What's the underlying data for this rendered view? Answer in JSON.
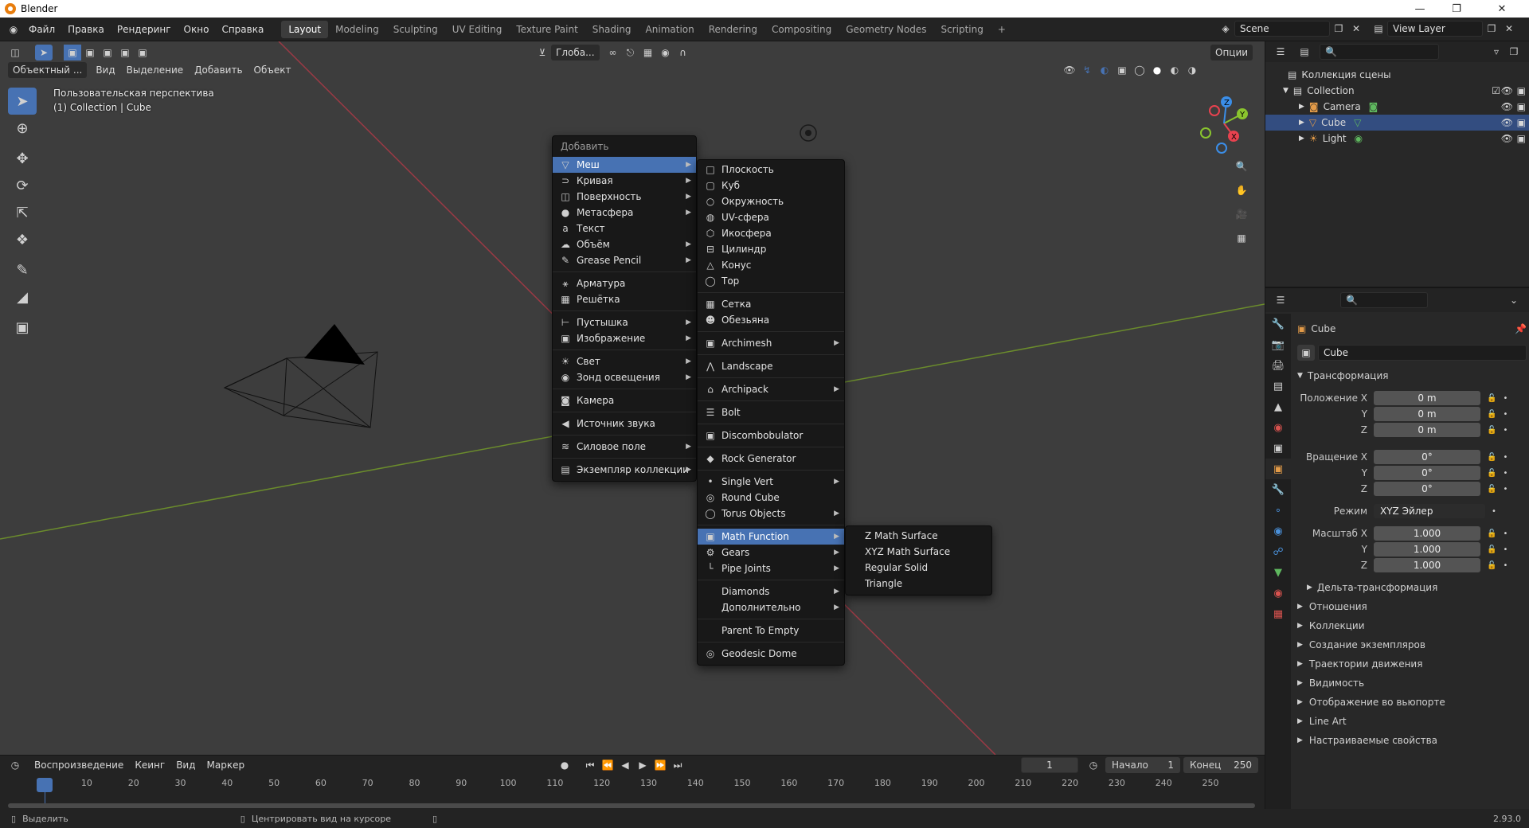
{
  "window": {
    "title": "Blender"
  },
  "topbar": {
    "menus": [
      "Файл",
      "Правка",
      "Рендеринг",
      "Окно",
      "Справка"
    ],
    "workspaces": [
      "Layout",
      "Modeling",
      "Sculpting",
      "UV Editing",
      "Texture Paint",
      "Shading",
      "Animation",
      "Rendering",
      "Compositing",
      "Geometry Nodes",
      "Scripting"
    ],
    "active_workspace": "Layout",
    "add_workspace": "+",
    "scene": "Scene",
    "view_layer": "View Layer"
  },
  "viewport_header": {
    "mode": "Объектный ...",
    "menus": [
      "Вид",
      "Выделение",
      "Добавить",
      "Объект"
    ],
    "transform_orientation": "Глоба...",
    "options": "Опции"
  },
  "viewport": {
    "perspective": "Пользовательская перспектива",
    "collection_info": "(1) Collection | Cube"
  },
  "add_menu": {
    "title": "Добавить",
    "items": [
      {
        "label": "Меш",
        "icon": "mesh-icon",
        "sub": true,
        "hl": true
      },
      {
        "label": "Кривая",
        "icon": "curve-icon",
        "sub": true
      },
      {
        "label": "Поверхность",
        "icon": "surface-icon",
        "sub": true
      },
      {
        "label": "Метасфера",
        "icon": "metaball-icon",
        "sub": true
      },
      {
        "label": "Текст",
        "icon": "text-icon"
      },
      {
        "label": "Объём",
        "icon": "volume-icon",
        "sub": true
      },
      {
        "label": "Grease Pencil",
        "icon": "grease-pencil-icon",
        "sub": true
      },
      {
        "sep": true
      },
      {
        "label": "Арматура",
        "icon": "armature-icon"
      },
      {
        "label": "Решётка",
        "icon": "lattice-icon"
      },
      {
        "sep": true
      },
      {
        "label": "Пустышка",
        "icon": "empty-icon",
        "sub": true
      },
      {
        "label": "Изображение",
        "icon": "image-icon",
        "sub": true
      },
      {
        "sep": true
      },
      {
        "label": "Свет",
        "icon": "light-icon",
        "sub": true
      },
      {
        "label": "Зонд освещения",
        "icon": "light-probe-icon",
        "sub": true
      },
      {
        "sep": true
      },
      {
        "label": "Камера",
        "icon": "camera-icon"
      },
      {
        "sep": true
      },
      {
        "label": "Источник звука",
        "icon": "speaker-icon"
      },
      {
        "sep": true
      },
      {
        "label": "Силовое поле",
        "icon": "force-field-icon",
        "sub": true
      },
      {
        "sep": true
      },
      {
        "label": "Экземпляр коллекции",
        "icon": "collection-instance-icon",
        "sub": true
      }
    ]
  },
  "mesh_menu": {
    "items": [
      {
        "label": "Плоскость",
        "icon": "plane-icon"
      },
      {
        "label": "Куб",
        "icon": "cube-icon"
      },
      {
        "label": "Окружность",
        "icon": "circle-icon"
      },
      {
        "label": "UV-сфера",
        "icon": "uv-sphere-icon"
      },
      {
        "label": "Икосфера",
        "icon": "icosphere-icon"
      },
      {
        "label": "Цилиндр",
        "icon": "cylinder-icon"
      },
      {
        "label": "Конус",
        "icon": "cone-icon"
      },
      {
        "label": "Тор",
        "icon": "torus-icon"
      },
      {
        "sep": true
      },
      {
        "label": "Сетка",
        "icon": "grid-icon"
      },
      {
        "label": "Обезьяна",
        "icon": "monkey-icon"
      },
      {
        "sep": true
      },
      {
        "label": "Archimesh",
        "icon": "archimesh-icon",
        "sub": true
      },
      {
        "sep": true
      },
      {
        "label": "Landscape",
        "icon": "landscape-icon"
      },
      {
        "sep": true
      },
      {
        "label": "Archipack",
        "icon": "archipack-icon",
        "sub": true
      },
      {
        "sep": true
      },
      {
        "label": "Bolt",
        "icon": "bolt-icon"
      },
      {
        "sep": true
      },
      {
        "label": "Discombobulator",
        "icon": "discombobulator-icon"
      },
      {
        "sep": true
      },
      {
        "label": "Rock Generator",
        "icon": "rock-icon"
      },
      {
        "sep": true
      },
      {
        "label": "Single Vert",
        "icon": "vertex-icon",
        "sub": true
      },
      {
        "label": "Round Cube",
        "icon": "round-cube-icon"
      },
      {
        "label": "Torus Objects",
        "icon": "torus-objects-icon",
        "sub": true
      },
      {
        "sep": true
      },
      {
        "label": "Math Function",
        "icon": "math-function-icon",
        "sub": true,
        "hl": true
      },
      {
        "label": "Gears",
        "icon": "gears-icon",
        "sub": true
      },
      {
        "label": "Pipe Joints",
        "icon": "pipe-joints-icon",
        "sub": true
      },
      {
        "sep": true
      },
      {
        "label": "Diamonds",
        "icon": "",
        "sub": true
      },
      {
        "label": "Дополнительно",
        "icon": "",
        "sub": true
      },
      {
        "sep": true
      },
      {
        "label": "Parent To Empty",
        "icon": ""
      },
      {
        "sep": true
      },
      {
        "label": "Geodesic Dome",
        "icon": "geodesic-dome-icon"
      }
    ]
  },
  "math_menu": {
    "items": [
      "Z Math Surface",
      "XYZ Math Surface",
      "Regular Solid",
      "Triangle"
    ]
  },
  "outliner": {
    "title": "Коллекция сцены",
    "collection": "Collection",
    "objects": [
      {
        "name": "Camera",
        "selected": false,
        "color": "#e39b48"
      },
      {
        "name": "Cube",
        "selected": true,
        "color": "#e39b48"
      },
      {
        "name": "Light",
        "selected": false,
        "color": "#e39b48"
      }
    ]
  },
  "properties": {
    "object_name": "Cube",
    "object_field": "Cube",
    "section_transform": "Трансформация",
    "location_label": "Положение X",
    "location": [
      "0 m",
      "0 m",
      "0 m"
    ],
    "rotation_label": "Вращение X",
    "rotation": [
      "0°",
      "0°",
      "0°"
    ],
    "mode_label": "Режим",
    "mode_value": "XYZ Эйлер",
    "scale_label": "Масштаб X",
    "scale": [
      "1.000",
      "1.000",
      "1.000"
    ],
    "axis_y": "Y",
    "axis_z": "Z",
    "delta": "Дельта-трансформация",
    "sections": [
      "Отношения",
      "Коллекции",
      "Создание экземпляров",
      "Траектории движения",
      "Видимость",
      "Отображение во вьюпорте",
      "Line Art",
      "Настраиваемые свойства"
    ]
  },
  "timeline": {
    "menus": [
      "Воспроизведение",
      "Кеинг",
      "Вид",
      "Маркер"
    ],
    "current_frame": "1",
    "start_label": "Начало",
    "start": "1",
    "end_label": "Конец",
    "end": "250",
    "ticks": [
      "1",
      "10",
      "20",
      "30",
      "40",
      "50",
      "60",
      "70",
      "80",
      "90",
      "100",
      "110",
      "120",
      "130",
      "140",
      "150",
      "160",
      "170",
      "180",
      "190",
      "200",
      "210",
      "220",
      "230",
      "240",
      "250"
    ]
  },
  "statusbar": {
    "select": "Выделить",
    "center": "Центрировать вид на курсоре",
    "version": "2.93.0"
  },
  "colors": {
    "accent": "#4772b3",
    "selection": "#334d80",
    "x_axis": "#e8424f",
    "y_axis": "#8ac52e",
    "z_axis": "#3b8ee8"
  }
}
